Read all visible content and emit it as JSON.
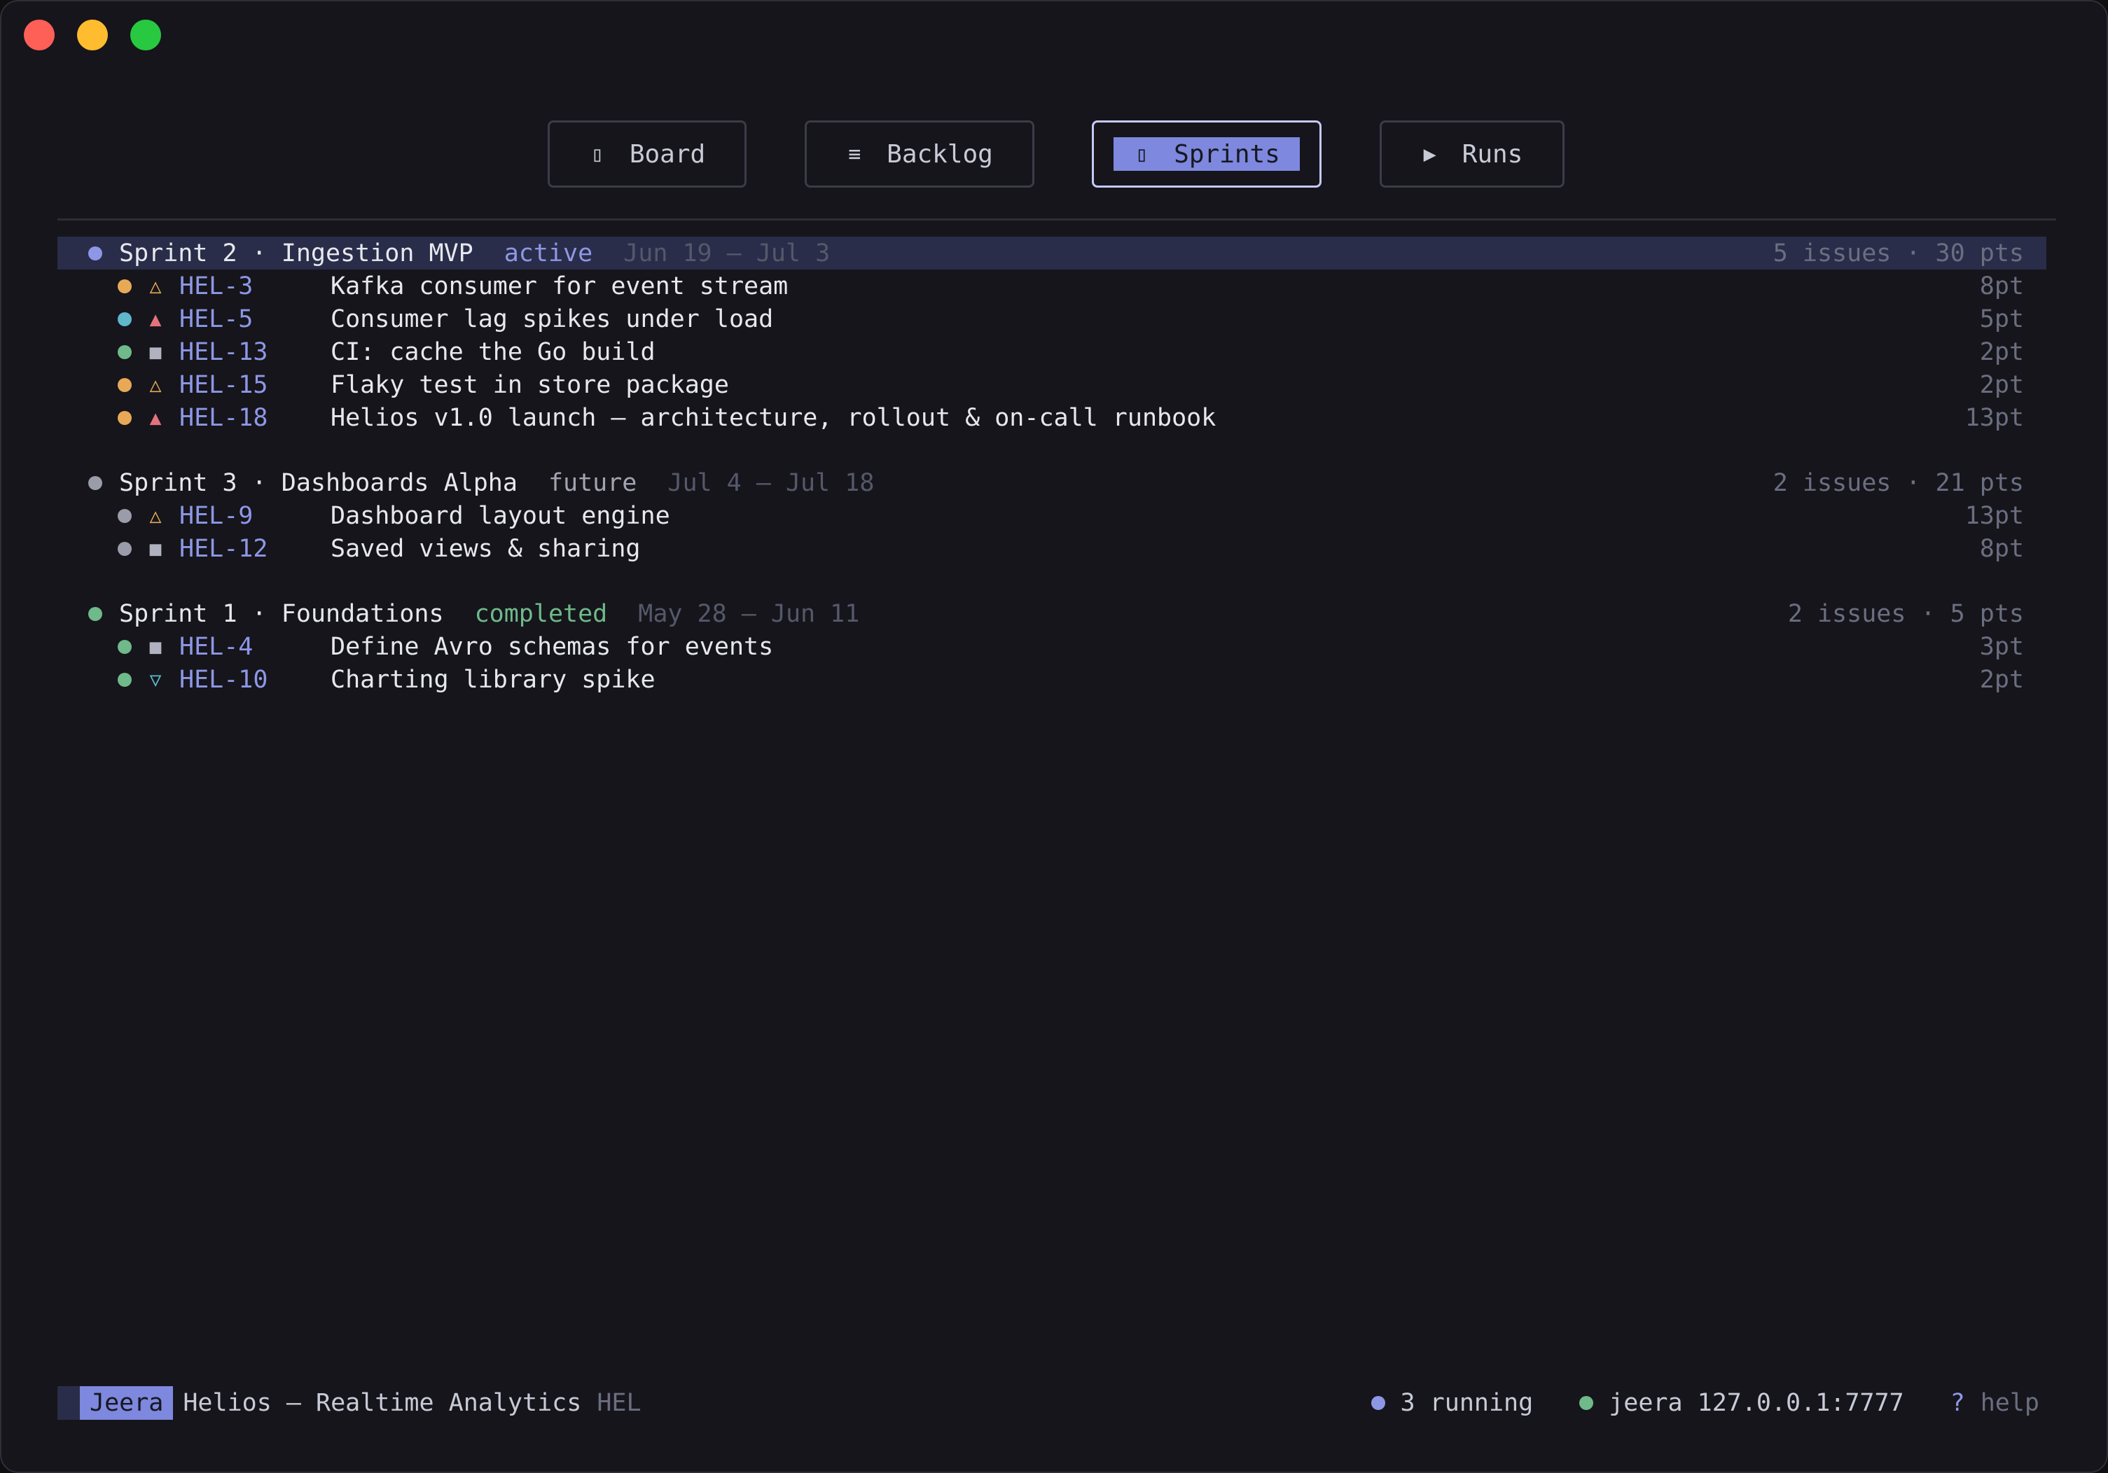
{
  "tabs": [
    {
      "label": "Board",
      "icon": "▯"
    },
    {
      "label": "Backlog",
      "icon": "≡"
    },
    {
      "label": "Sprints",
      "icon": "▯"
    },
    {
      "label": "Runs",
      "icon": "▶"
    }
  ],
  "sprints": [
    {
      "name": "Sprint 2 · Ingestion MVP",
      "status": "active",
      "dates": "Jun 19 – Jul 3",
      "summary": "5 issues · 30 pts",
      "issues": [
        {
          "key": "HEL-3",
          "title": "Kafka consumer for event stream",
          "points": "8pt",
          "shape": "△"
        },
        {
          "key": "HEL-5",
          "title": "Consumer lag spikes under load",
          "points": "5pt",
          "shape": "▲"
        },
        {
          "key": "HEL-13",
          "title": "CI: cache the Go build",
          "points": "2pt",
          "shape": "■"
        },
        {
          "key": "HEL-15",
          "title": "Flaky test in store package",
          "points": "2pt",
          "shape": "△"
        },
        {
          "key": "HEL-18",
          "title": "Helios v1.0 launch — architecture, rollout & on-call runbook",
          "points": "13pt",
          "shape": "▲"
        }
      ]
    },
    {
      "name": "Sprint 3 · Dashboards Alpha",
      "status": "future",
      "dates": "Jul 4 – Jul 18",
      "summary": "2 issues · 21 pts",
      "issues": [
        {
          "key": "HEL-9",
          "title": "Dashboard layout engine",
          "points": "13pt",
          "shape": "△"
        },
        {
          "key": "HEL-12",
          "title": "Saved views & sharing",
          "points": "8pt",
          "shape": "■"
        }
      ]
    },
    {
      "name": "Sprint 1 · Foundations",
      "status": "completed",
      "dates": "May 28 – Jun 11",
      "summary": "2 issues · 5 pts",
      "issues": [
        {
          "key": "HEL-4",
          "title": "Define Avro schemas for events",
          "points": "3pt",
          "shape": "■"
        },
        {
          "key": "HEL-10",
          "title": "Charting library spike",
          "points": "2pt",
          "shape": "▽"
        }
      ]
    }
  ],
  "statusbar": {
    "app": "Jeera",
    "project": "Helios — Realtime Analytics",
    "project_key": "HEL",
    "running": "3 running",
    "server": "jeera 127.0.0.1:7777",
    "help_key": "?",
    "help_label": "help"
  },
  "colors": {
    "accent": "#7d88de",
    "status_active": "#8e97e6",
    "status_future": "#a2a4b0",
    "status_completed": "#6fb98a",
    "dot_orange": "#e8a957",
    "dot_teal": "#5fb7c9",
    "dot_green": "#6fb98a",
    "dot_gray": "#9a9caa",
    "shape_red": "#e3727c",
    "shape_gray": "#b0b2bf"
  }
}
